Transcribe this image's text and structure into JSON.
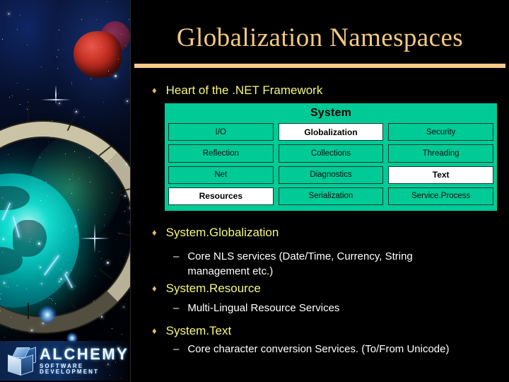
{
  "slide": {
    "title": "Globalization Namespaces"
  },
  "logo": {
    "name": "ALCHEMY",
    "tagline": "SOFTWARE DEVELOPMENT"
  },
  "bullets": {
    "marker_level1": "♦",
    "marker_level2": "–",
    "heart": "Heart of the .NET Framework",
    "globalization": "System.Globalization",
    "globalization_detail": "Core NLS services (Date/Time, Currency, String management etc.)",
    "resource": "System.Resource",
    "resource_detail": "Multi-Lingual Resource Services",
    "text": "System.Text",
    "text_detail": "Core character conversion Services. (To/From Unicode)"
  },
  "namespace_table": {
    "header": "System",
    "cells": [
      {
        "label": "I/O",
        "highlighted": false
      },
      {
        "label": "Globalization",
        "highlighted": true
      },
      {
        "label": "Security",
        "highlighted": false
      },
      {
        "label": "Reflection",
        "highlighted": false
      },
      {
        "label": "Collections",
        "highlighted": false
      },
      {
        "label": "Threading",
        "highlighted": false
      },
      {
        "label": "Net",
        "highlighted": false
      },
      {
        "label": "Diagnostics",
        "highlighted": false
      },
      {
        "label": "Text",
        "highlighted": true
      },
      {
        "label": "Resources",
        "highlighted": true
      },
      {
        "label": "Serialization",
        "highlighted": false
      },
      {
        "label": "Service.Process",
        "highlighted": false
      }
    ]
  },
  "colors": {
    "background": "#000000",
    "title": "#f3c97e",
    "rule": "#f8cb86",
    "bullet_level1_text": "#f7f77a",
    "bullet_level2_text": "#ffffff",
    "table_green": "#00cb97",
    "table_highlight": "#ffffff"
  }
}
